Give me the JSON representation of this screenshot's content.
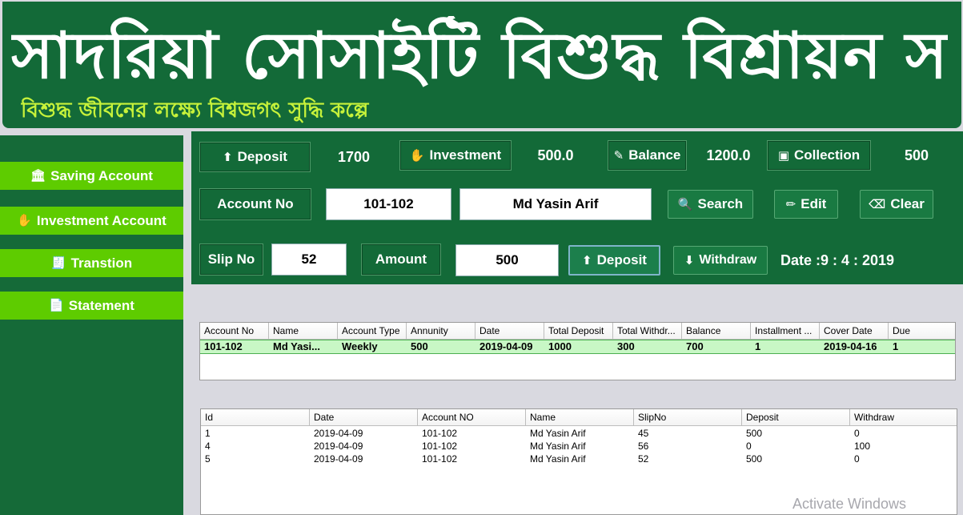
{
  "banner": {
    "title": "সাদরিয়া সোসাইটি বিশুদ্ধ বিশ্রায়ন সমবায় সমিতি",
    "subtitle": "বিশুদ্ধ জীবনের লক্ষ্যে বিশ্বজগৎ সুদ্ধি কল্পে"
  },
  "sidebar": {
    "items": [
      {
        "label": "Saving Account",
        "icon": "bank-icon"
      },
      {
        "label": "Investment Account",
        "icon": "hand-coins-icon"
      },
      {
        "label": "Transtion",
        "icon": "receipt-icon"
      },
      {
        "label": "Statement",
        "icon": "document-icon"
      }
    ]
  },
  "summary": {
    "deposit_label": "Deposit",
    "deposit_value": "1700",
    "investment_label": "Investment",
    "investment_value": "500.0",
    "balance_label": "Balance",
    "balance_value": "1200.0",
    "collection_label": "Collection",
    "collection_value": "500"
  },
  "account": {
    "label": "Account No",
    "number": "101-102",
    "name": "Md Yasin Arif",
    "search_label": "Search",
    "edit_label": "Edit",
    "clear_label": "Clear"
  },
  "transaction": {
    "slip_label": "Slip No",
    "slip_value": "52",
    "amount_label": "Amount",
    "amount_value": "500",
    "deposit_label": "Deposit",
    "withdraw_label": "Withdraw",
    "date_text": "Date :9 : 4 : 2019"
  },
  "account_table": {
    "columns": [
      "Account No",
      "Name",
      "Account Type",
      "Annunity",
      "Date",
      "Total Deposit",
      "Total Withdr...",
      "Balance",
      "Installment ...",
      "Cover Date",
      "Due"
    ],
    "rows": [
      [
        "101-102",
        "Md Yasi...",
        "Weekly",
        "500",
        "2019-04-09",
        "1000",
        "300",
        "700",
        "1",
        "2019-04-16",
        "1"
      ]
    ]
  },
  "transaction_table": {
    "columns": [
      "Id",
      "Date",
      "Account NO",
      "Name",
      "SlipNo",
      "Deposit",
      "Withdraw"
    ],
    "rows": [
      [
        "1",
        "2019-04-09",
        "101-102",
        "Md Yasin Arif",
        "45",
        "500",
        "0"
      ],
      [
        "4",
        "2019-04-09",
        "101-102",
        "Md Yasin Arif",
        "56",
        "0",
        "100"
      ],
      [
        "5",
        "2019-04-09",
        "101-102",
        "Md Yasin Arif",
        "52",
        "500",
        "0"
      ]
    ]
  },
  "watermark": "Activate Windows",
  "colors": {
    "primary_green": "#136a38",
    "sidebar_button": "#5ecc00",
    "selected_row": "#c8f7c5"
  }
}
